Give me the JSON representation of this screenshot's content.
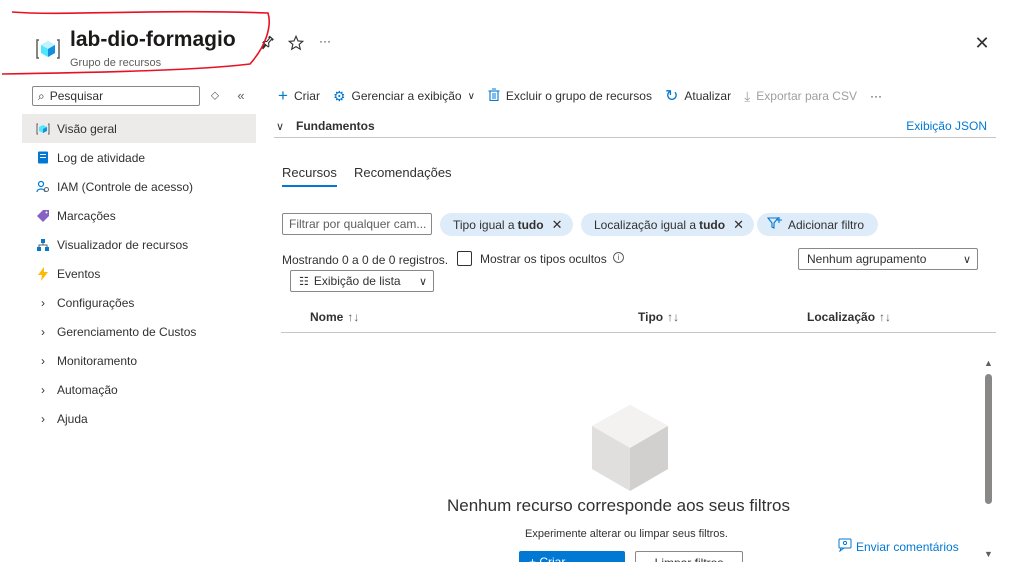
{
  "header": {
    "title": "lab-dio-formagio",
    "subtitle": "Grupo de recursos",
    "more_label": "···",
    "close_label": "✕"
  },
  "sidebar": {
    "search_placeholder": "Pesquisar",
    "items": [
      {
        "label": "Visão geral",
        "icon": "resource-group-icon",
        "active": true
      },
      {
        "label": "Log de atividade",
        "icon": "activity-log-icon"
      },
      {
        "label": "IAM (Controle de acesso)",
        "icon": "iam-icon"
      },
      {
        "label": "Marcações",
        "icon": "tag-icon"
      },
      {
        "label": "Visualizador de recursos",
        "icon": "resource-visualizer-icon"
      },
      {
        "label": "Eventos",
        "icon": "events-icon"
      },
      {
        "label": "Configurações",
        "expandable": true
      },
      {
        "label": "Gerenciamento de Custos",
        "expandable": true
      },
      {
        "label": "Monitoramento",
        "expandable": true
      },
      {
        "label": "Automação",
        "expandable": true
      },
      {
        "label": "Ajuda",
        "expandable": true
      }
    ]
  },
  "toolbar": {
    "create": "Criar",
    "manage_view": "Gerenciar a exibição",
    "delete_group": "Excluir o grupo de recursos",
    "refresh": "Atualizar",
    "export_csv": "Exportar para CSV",
    "more": "···"
  },
  "essentials": {
    "label": "Fundamentos",
    "json_view": "Exibição JSON"
  },
  "tabs": [
    {
      "label": "Recursos",
      "active": true
    },
    {
      "label": "Recomendações"
    }
  ],
  "filters": {
    "input_placeholder": "Filtrar por qualquer cam...",
    "type_prefix": "Tipo igual a",
    "type_value": "tudo",
    "location_prefix": "Localização igual a",
    "location_value": "tudo",
    "add_filter": "Adicionar filtro"
  },
  "results": {
    "showing": "Mostrando 0 a 0 de 0 registros.",
    "show_hidden": "Mostrar os tipos ocultos",
    "grouping": "Nenhum agrupamento",
    "list_view": "Exibição de lista"
  },
  "columns": {
    "name": "Nome",
    "type": "Tipo",
    "location": "Localização"
  },
  "empty_state": {
    "title": "Nenhum recurso corresponde aos seus filtros",
    "subtitle": "Experimente alterar ou limpar seus filtros.",
    "create_button": "+ Criar",
    "clear_button": "Limpar filtros"
  },
  "feedback": "Enviar comentários",
  "colors": {
    "accent": "#0078d4",
    "annotation": "#e81123"
  }
}
